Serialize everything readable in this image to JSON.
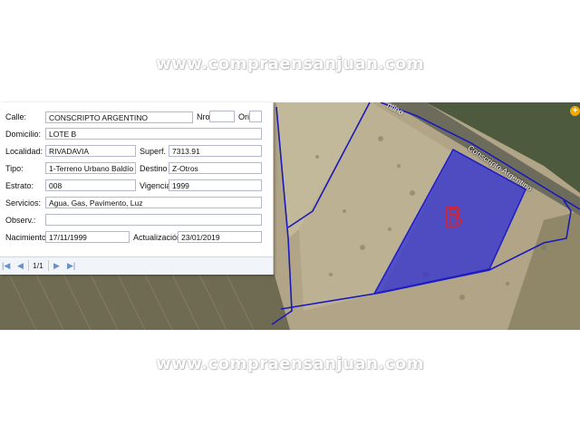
{
  "watermark": {
    "top": "www.compraensanjuan.com",
    "bottom": "www.compraensanjuan.com"
  },
  "form": {
    "calle_label": "Calle:",
    "calle_value": "CONSCRIPTO ARGENTINO",
    "nro_label": "Nro",
    "nro_value": "",
    "ori_label": "Ori",
    "ori_value": "",
    "domicilio_label": "Domicilio:",
    "domicilio_value": "LOTE B",
    "localidad_label": "Localidad:",
    "localidad_value": "RIVADAVIA",
    "superf_label": "Superf.",
    "superf_value": "7313.91",
    "tipo_label": "Tipo:",
    "tipo_value": "1-Terreno Urbano Baldío",
    "destino_label": "Destino",
    "destino_value": "Z-Otros",
    "estrato_label": "Estrato:",
    "estrato_value": "008",
    "vigencia_label": "Vigencia",
    "vigencia_value": "1999",
    "servicios_label": "Servicios:",
    "servicios_value": "Agua, Gas, Pavimento, Luz",
    "observ_label": "Observ.:",
    "observ_value": "",
    "nacimiento_label": "Nacimiento:",
    "nacimiento_value": "17/11/1999",
    "actualizacion_label": "Actualización",
    "actualizacion_value": "23/01/2019"
  },
  "pager": {
    "page_text": "1/1"
  },
  "map": {
    "street_label": "Conscripto Argentino",
    "street_label_partial": "ntino",
    "lot_marker": "B",
    "parcel_color": "#2a2ad8",
    "marker_color": "#e02020"
  }
}
